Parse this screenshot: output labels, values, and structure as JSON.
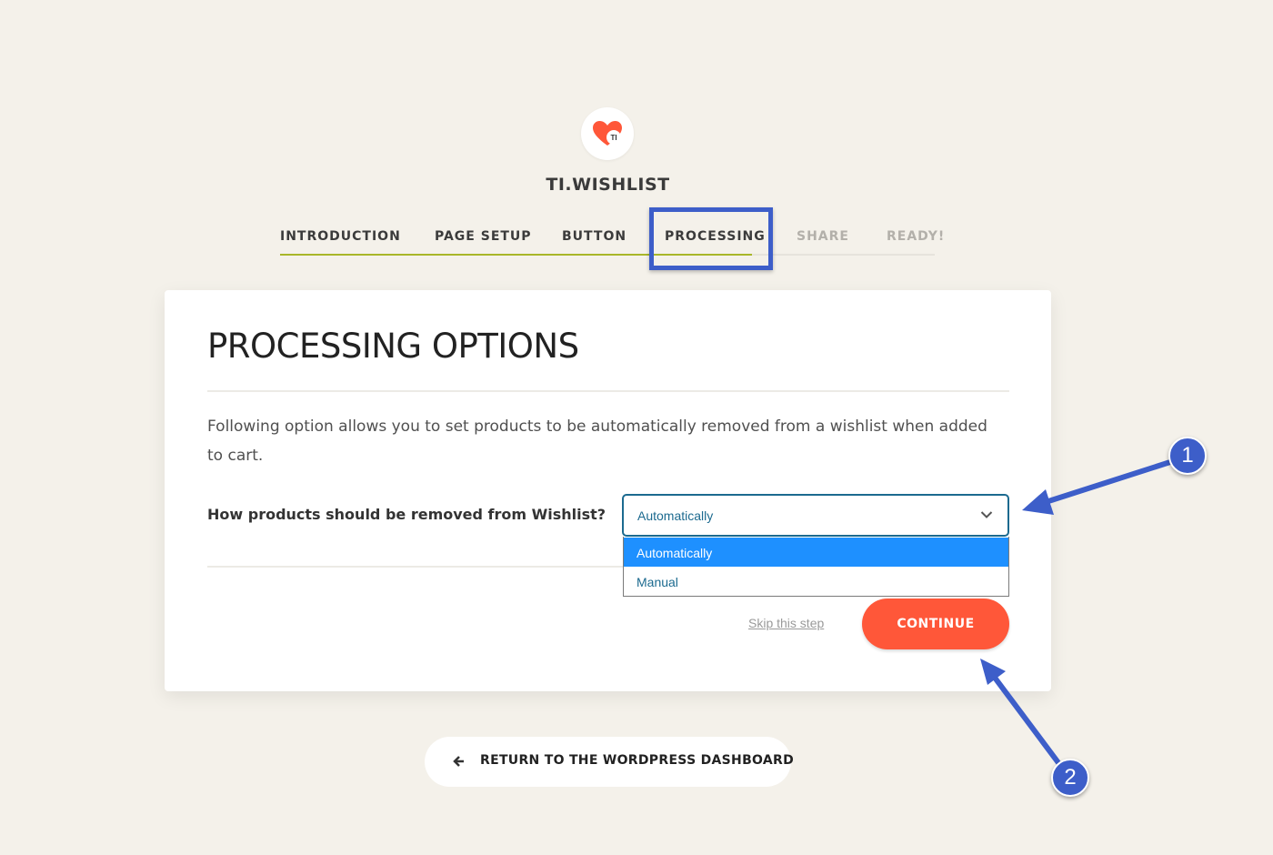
{
  "brand": {
    "logo_icon": "heart-icon",
    "logo_text": "TI",
    "title": "TI.WISHLIST"
  },
  "steps": [
    {
      "label": "INTRODUCTION",
      "state": "done"
    },
    {
      "label": "PAGE SETUP",
      "state": "done"
    },
    {
      "label": "BUTTON",
      "state": "done"
    },
    {
      "label": "PROCESSING",
      "state": "current"
    },
    {
      "label": "SHARE",
      "state": "upcoming"
    },
    {
      "label": "READY!",
      "state": "upcoming"
    }
  ],
  "card": {
    "heading": "PROCESSING OPTIONS",
    "description": "Following option allows you to set products to be automatically removed from a wishlist when added to cart.",
    "question": "How products should be removed from Wishlist?",
    "select": {
      "value": "Automatically",
      "options": [
        "Automatically",
        "Manual"
      ]
    },
    "skip_label": "Skip this step",
    "continue_label": "CONTINUE"
  },
  "return_label": "RETURN TO THE WORDPRESS DASHBOARD",
  "annotations": {
    "badge1": "1",
    "badge2": "2"
  },
  "colors": {
    "background": "#f4f1ea",
    "accent": "#ff5739",
    "progress": "#a8b62a",
    "annotation": "#3d5ec9",
    "select_text": "#1c6a8f",
    "option_highlight": "#1e90ff"
  }
}
